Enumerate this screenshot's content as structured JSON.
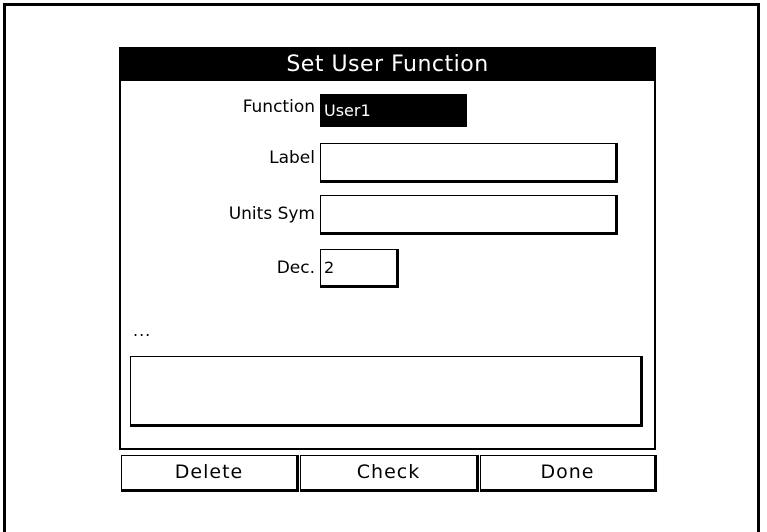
{
  "dialog": {
    "title": "Set User Function",
    "function": {
      "label": "Function",
      "value": "User1"
    },
    "label_field": {
      "label": "Label",
      "value": ""
    },
    "units_field": {
      "label": "Units Sym",
      "value": ""
    },
    "dec_field": {
      "label": "Dec.",
      "value": "2"
    },
    "status_text": "...",
    "message": ""
  },
  "softkeys": [
    {
      "label": "Delete"
    },
    {
      "label": "Check"
    },
    {
      "label": "Done"
    }
  ]
}
